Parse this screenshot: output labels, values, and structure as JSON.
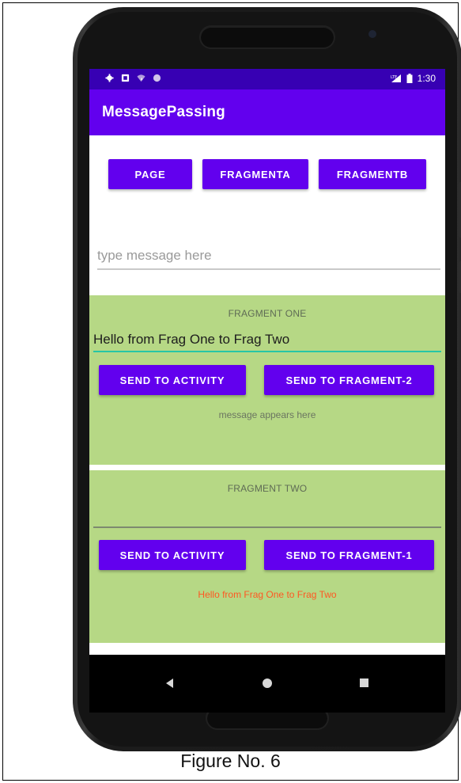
{
  "status_bar": {
    "time": "1:30",
    "icons": [
      "settings-icon",
      "sim-icon",
      "wifi-icon",
      "sync-icon"
    ],
    "right_icons": [
      "signal-icon",
      "battery-icon"
    ],
    "color": "#3700b3"
  },
  "app_bar": {
    "title": "MessagePassing",
    "color": "#6200ee"
  },
  "top_buttons": {
    "page": "PAGE",
    "fragment_a": "FRAGMENTA",
    "fragment_b": "FRAGMENTB"
  },
  "activity_input": {
    "value": "",
    "placeholder": "type message here"
  },
  "fragment_one": {
    "title": "FRAGMENT ONE",
    "input_value": "Hello from Frag One to Frag Two",
    "send_to_activity": "SEND TO ACTIVITY",
    "send_to_fragment": "SEND TO FRAGMENT-2",
    "message": "message appears here",
    "background": "#b6d885",
    "focus_underline": "#26c6a6"
  },
  "fragment_two": {
    "title": "FRAGMENT TWO",
    "input_value": "",
    "send_to_activity": "SEND TO ACTIVITY",
    "send_to_fragment": "SEND TO FRAGMENT-1",
    "message": "Hello from Frag One to Frag Two",
    "message_color": "#ff5722"
  },
  "nav_bar": {
    "icons": [
      "back-icon",
      "home-icon",
      "recents-icon"
    ]
  },
  "caption": "Figure No. 6"
}
